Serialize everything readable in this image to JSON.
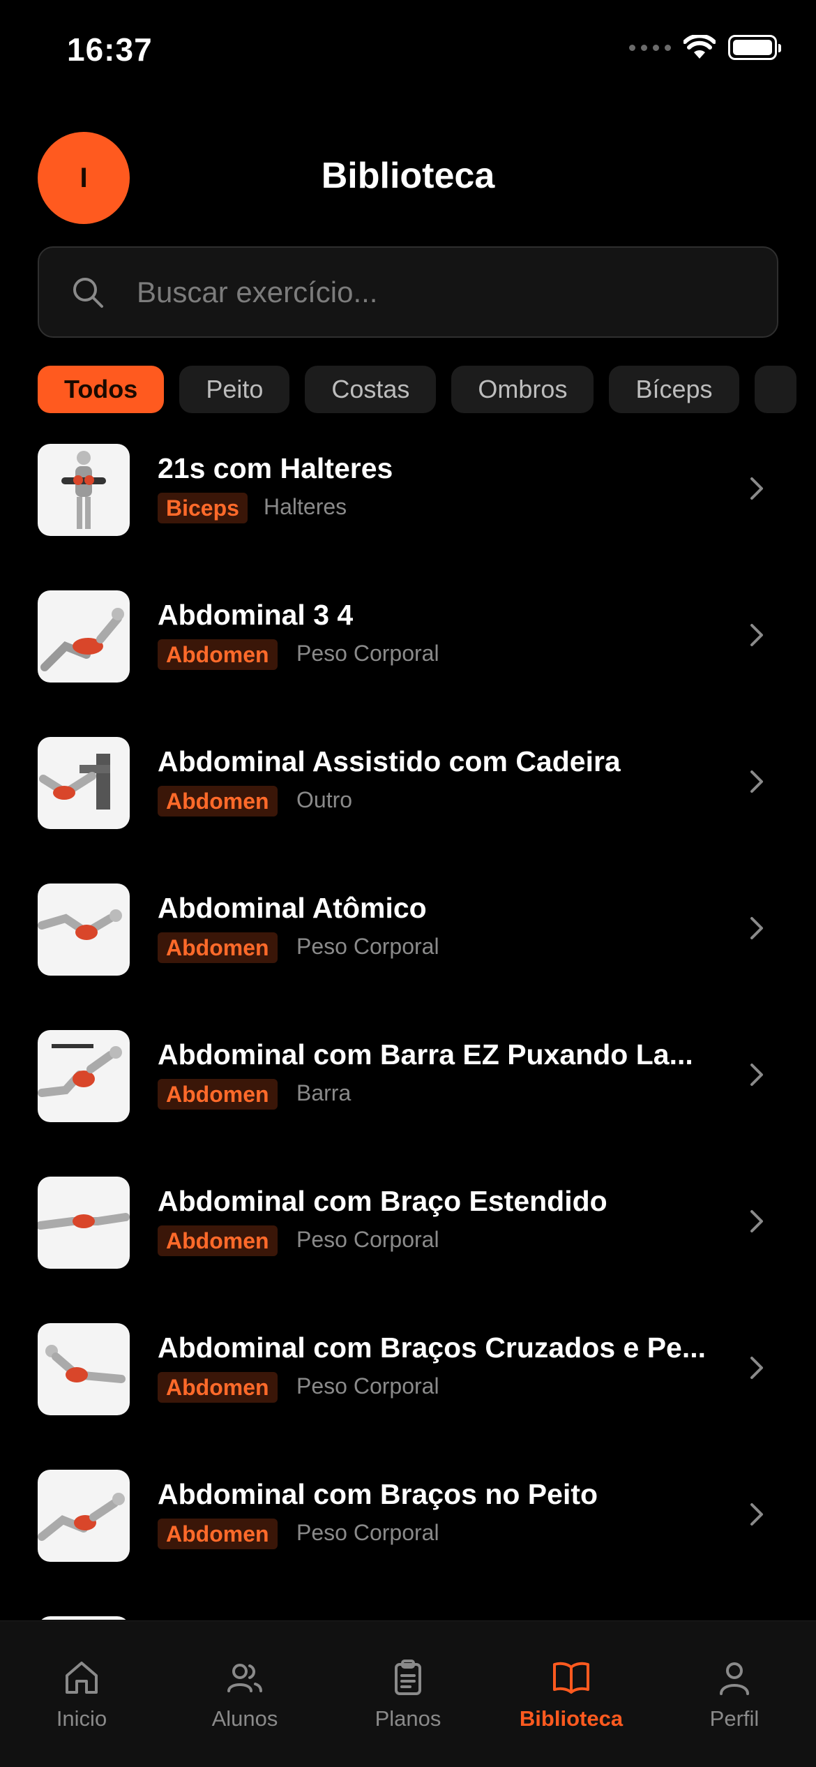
{
  "status_bar": {
    "time": "16:37"
  },
  "header": {
    "avatar_initial": "I",
    "title": "Biblioteca"
  },
  "search": {
    "placeholder": "Buscar exercício..."
  },
  "filters": [
    {
      "label": "Todos",
      "active": true
    },
    {
      "label": "Peito",
      "active": false
    },
    {
      "label": "Costas",
      "active": false
    },
    {
      "label": "Ombros",
      "active": false
    },
    {
      "label": "Bíceps",
      "active": false
    }
  ],
  "exercises": [
    {
      "name": "21s com Halteres",
      "tag": "Biceps",
      "equipment": "Halteres"
    },
    {
      "name": "Abdominal 3 4",
      "tag": "Abdomen",
      "equipment": "Peso Corporal"
    },
    {
      "name": "Abdominal Assistido com Cadeira",
      "tag": "Abdomen",
      "equipment": "Outro"
    },
    {
      "name": "Abdominal Atômico",
      "tag": "Abdomen",
      "equipment": "Peso Corporal"
    },
    {
      "name": "Abdominal com Barra EZ Puxando La...",
      "tag": "Abdomen",
      "equipment": "Barra"
    },
    {
      "name": "Abdominal com Braço Estendido",
      "tag": "Abdomen",
      "equipment": "Peso Corporal"
    },
    {
      "name": "Abdominal com Braços Cruzados e Pe...",
      "tag": "Abdomen",
      "equipment": "Peso Corporal"
    },
    {
      "name": "Abdominal com Braços no Peito",
      "tag": "Abdomen",
      "equipment": "Peso Corporal"
    }
  ],
  "tabbar": [
    {
      "label": "Inicio",
      "icon": "home-icon",
      "active": false
    },
    {
      "label": "Alunos",
      "icon": "users-icon",
      "active": false
    },
    {
      "label": "Planos",
      "icon": "clipboard-icon",
      "active": false
    },
    {
      "label": "Biblioteca",
      "icon": "book-icon",
      "active": true
    },
    {
      "label": "Perfil",
      "icon": "user-icon",
      "active": false
    }
  ],
  "colors": {
    "accent": "#ff5a1f",
    "background": "#000000",
    "tag_bg": "#3a1608"
  }
}
